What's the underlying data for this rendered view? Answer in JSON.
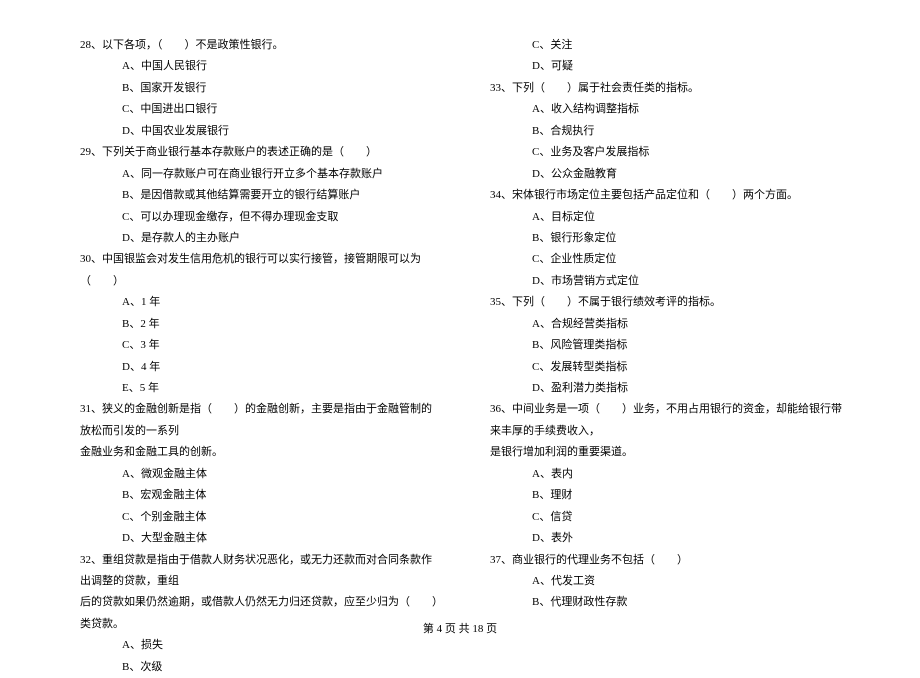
{
  "col1": {
    "q28": {
      "stem": "28、以下各项，（　　）不是政策性银行。",
      "a": "A、中国人民银行",
      "b": "B、国家开发银行",
      "c": "C、中国进出口银行",
      "d": "D、中国农业发展银行"
    },
    "q29": {
      "stem": "29、下列关于商业银行基本存款账户的表述正确的是（　　）",
      "a": "A、同一存款账户可在商业银行开立多个基本存款账户",
      "b": "B、是因借款或其他结算需要开立的银行结算账户",
      "c": "C、可以办理现金缴存，但不得办理现金支取",
      "d": "D、是存款人的主办账户"
    },
    "q30": {
      "stem": "30、中国银监会对发生信用危机的银行可以实行接管，接管期限可以为（　　）",
      "a": "A、1 年",
      "b": "B、2 年",
      "c": "C、3 年",
      "d": "D、4 年",
      "e": "E、5 年"
    },
    "q31": {
      "stem1": "31、狭义的金融创新是指（　　）的金融创新，主要是指由于金融管制的放松而引发的一系列",
      "stem2": "金融业务和金融工具的创新。",
      "a": "A、微观金融主体",
      "b": "B、宏观金融主体",
      "c": "C、个别金融主体",
      "d": "D、大型金融主体"
    },
    "q32": {
      "stem1": "32、重组贷款是指由于借款人财务状况恶化，或无力还款而对合同条款作出调整的贷款，重组",
      "stem2": "后的贷款如果仍然逾期，或借款人仍然无力归还贷款，应至少归为（　　）类贷款。",
      "a": "A、损失",
      "b": "B、次级"
    }
  },
  "col2": {
    "q32cont": {
      "c": "C、关注",
      "d": "D、可疑"
    },
    "q33": {
      "stem": "33、下列（　　）属于社会责任类的指标。",
      "a": "A、收入结构调整指标",
      "b": "B、合规执行",
      "c": "C、业务及客户发展指标",
      "d": "D、公众金融教育"
    },
    "q34": {
      "stem": "34、宋体银行市场定位主要包括产品定位和（　　）两个方面。",
      "a": "A、目标定位",
      "b": "B、银行形象定位",
      "c": "C、企业性质定位",
      "d": "D、市场营销方式定位"
    },
    "q35": {
      "stem": "35、下列（　　）不属于银行绩效考评的指标。",
      "a": "A、合规经营类指标",
      "b": "B、风险管理类指标",
      "c": "C、发展转型类指标",
      "d": "D、盈利潜力类指标"
    },
    "q36": {
      "stem1": "36、中间业务是一项（　　）业务，不用占用银行的资金，却能给银行带来丰厚的手续费收入，",
      "stem2": "是银行增加利润的重要渠道。",
      "a": "A、表内",
      "b": "B、理财",
      "c": "C、信贷",
      "d": "D、表外"
    },
    "q37": {
      "stem": "37、商业银行的代理业务不包括（　　）",
      "a": "A、代发工资",
      "b": "B、代理财政性存款"
    }
  },
  "footer": "第 4 页 共 18 页"
}
